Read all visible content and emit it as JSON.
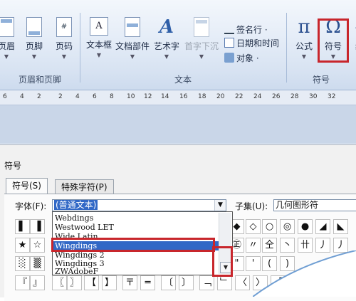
{
  "ribbon": {
    "groups": [
      {
        "label": "页眉和页脚"
      },
      {
        "label": "文本"
      },
      {
        "label": "符号"
      }
    ],
    "buttons": [
      {
        "label": "页眉",
        "icon": "header-icon"
      },
      {
        "label": "页脚",
        "icon": "footer-icon"
      },
      {
        "label": "页码",
        "icon": "page-number-icon"
      },
      {
        "label": "文本框",
        "icon": "textbox-icon"
      },
      {
        "label": "文档部件",
        "icon": "quick-parts-icon"
      },
      {
        "label": "艺术字",
        "icon": "wordart-icon"
      },
      {
        "label": "首字下沉",
        "icon": "dropcap-icon"
      },
      {
        "label": "公式",
        "icon": "pi-icon"
      },
      {
        "label": "符号",
        "icon": "omega-icon"
      },
      {
        "label": "编",
        "icon": "number-icon"
      }
    ],
    "small_buttons": [
      {
        "label": "签名行 ·",
        "icon": "signature-icon"
      },
      {
        "label": "日期和时间",
        "icon": "date-time-icon"
      },
      {
        "label": "对象 ·",
        "icon": "object-icon"
      }
    ]
  },
  "ruler": {
    "ticks": [
      "6",
      "4",
      "2",
      "2",
      "4",
      "6",
      "8",
      "10",
      "12",
      "14",
      "16",
      "18",
      "20",
      "22",
      "24",
      "26",
      "28",
      "30",
      "32"
    ]
  },
  "dialog": {
    "title": "符号",
    "tabs": [
      "符号(S)",
      "特殊字符(P)"
    ],
    "font_label": "字体(F):",
    "font_value": "(普通文本)",
    "subset_label": "子集(U):",
    "subset_value": "几何图形符",
    "font_options": [
      "Webdings",
      "Westwood LET",
      "Wide Latin",
      "Wingdings",
      "Wingdings 2",
      "Wingdings 3",
      "ZWAdobeF"
    ],
    "selected_font": "Wingdings",
    "symbols_row1": [
      "▌",
      "▐",
      "◆",
      "◇",
      "○",
      "◎",
      "●",
      "◢",
      "◣"
    ],
    "symbols_row2": [
      "★",
      "☆",
      "㊣",
      "〃",
      "仝",
      "丶",
      "卄",
      "丿",
      "丿"
    ],
    "symbols_row3": [
      "░",
      "▒",
      "\"",
      "'",
      "(",
      ")"
    ],
    "symbols_row4": [
      "『",
      "』",
      "〖",
      "〗",
      "【",
      "】",
      "〒",
      "═",
      "〔",
      "〕",
      "﹁",
      "﹂",
      "〈",
      "〉",
      "「",
      "」",
      "\"",
      "\""
    ]
  }
}
